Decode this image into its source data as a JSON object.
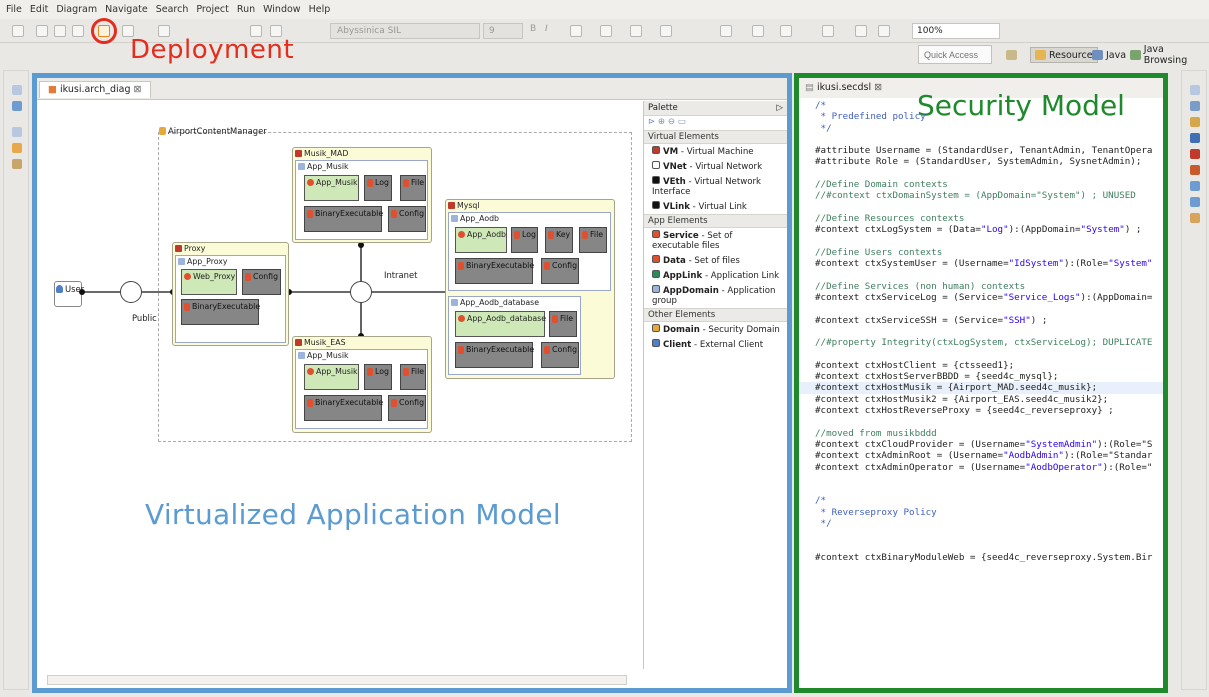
{
  "menubar": [
    "File",
    "Edit",
    "Diagram",
    "Navigate",
    "Search",
    "Project",
    "Run",
    "Window",
    "Help"
  ],
  "toolbar": {
    "font": "Abyssinica SIL",
    "size": "9",
    "zoom": "100%"
  },
  "quick_access": {
    "placeholder": "Quick Access"
  },
  "perspectives": [
    "Resource",
    "Java",
    "Java Browsing"
  ],
  "annotations": {
    "deployment": "Deployment",
    "virtualized": "Virtualized Application Model",
    "security": "Security Model"
  },
  "diagram": {
    "tab": "ikusi.arch_diag",
    "container": "AirportContentManager",
    "user": "User",
    "public": "Public",
    "intranet": "Intranet",
    "proxy": {
      "vm": "Proxy",
      "domain": "App_Proxy",
      "web": "Web_Proxy",
      "config": "Config",
      "bin": "BinaryExecutable"
    },
    "musik_mad": {
      "vm": "Musik_MAD",
      "domain": "App_Musik",
      "svc": "App_Musik",
      "log": "Log",
      "file": "File",
      "bin": "BinaryExecutable",
      "config": "Config"
    },
    "musik_eas": {
      "vm": "Musik_EAS",
      "domain": "App_Musik",
      "svc": "App_Musik",
      "log": "Log",
      "file": "File",
      "bin": "BinaryExecutable",
      "config": "Config"
    },
    "mysql": {
      "vm": "Mysql",
      "domain": "App_Aodb",
      "svc": "App_Aodb",
      "log": "Log",
      "key": "Key",
      "file": "File",
      "bin": "BinaryExecutable",
      "config": "Config",
      "domain2": "App_Aodb_database",
      "svc2": "App_Aodb_database",
      "file2": "File",
      "bin2": "BinaryExecutable",
      "config2": "Config"
    }
  },
  "palette": {
    "title": "Palette",
    "sections": [
      {
        "name": "Virtual Elements",
        "items": [
          {
            "b": "VM",
            "t": " - Virtual Machine"
          },
          {
            "b": "VNet",
            "t": " - Virtual Network"
          },
          {
            "b": "VEth",
            "t": " - Virtual Network Interface"
          },
          {
            "b": "VLink",
            "t": " - Virtual Link"
          }
        ]
      },
      {
        "name": "App Elements",
        "items": [
          {
            "b": "Service",
            "t": " - Set of executable files"
          },
          {
            "b": "Data",
            "t": " - Set of files"
          },
          {
            "b": "AppLink",
            "t": " - Application Link"
          },
          {
            "b": "AppDomain",
            "t": " - Application group"
          }
        ]
      },
      {
        "name": "Other Elements",
        "items": [
          {
            "b": "Domain",
            "t": " - Security Domain"
          },
          {
            "b": "Client",
            "t": " - External Client"
          }
        ]
      }
    ]
  },
  "security": {
    "tab": "ikusi.secdsl",
    "lines": [
      {
        "c": "jd",
        "t": "/*"
      },
      {
        "c": "jd",
        "t": " * Predefined policy"
      },
      {
        "c": "jd",
        "t": " */"
      },
      {
        "c": "",
        "t": ""
      },
      {
        "c": "",
        "t": "#attribute Username = (StandardUser, TenantAdmin, TenantOpera"
      },
      {
        "c": "",
        "t": "#attribute Role = (StandardUser, SystemAdmin, SysnetAdmin);"
      },
      {
        "c": "",
        "t": ""
      },
      {
        "c": "cm",
        "t": "//Define Domain contexts"
      },
      {
        "c": "cm",
        "t": "//#context ctxDomainSystem = (AppDomain=\"System\") ; UNUSED"
      },
      {
        "c": "",
        "t": ""
      },
      {
        "c": "cm",
        "t": "//Define Resources contexts"
      },
      {
        "c": "",
        "t": "#context ctxLogSystem = (Data=\"Log\"):(AppDomain=\"System\") ;"
      },
      {
        "c": "",
        "t": ""
      },
      {
        "c": "cm",
        "t": "//Define Users contexts"
      },
      {
        "c": "",
        "t": "#context ctxSystemUser = (Username=\"IdSystem\"):(Role=\"System\""
      },
      {
        "c": "",
        "t": ""
      },
      {
        "c": "cm",
        "t": "//Define Services (non human) contexts"
      },
      {
        "c": "",
        "t": "#context ctxServiceLog = (Service=\"Service_Logs\"):(AppDomain="
      },
      {
        "c": "",
        "t": ""
      },
      {
        "c": "",
        "t": "#context ctxServiceSSH = (Service=\"SSH\") ;"
      },
      {
        "c": "",
        "t": ""
      },
      {
        "c": "cm",
        "t": "//#property Integrity(ctxLogSystem, ctxServiceLog); DUPLICATE"
      },
      {
        "c": "",
        "t": ""
      },
      {
        "c": "",
        "t": "#context ctxHostClient = {ctsseed1};"
      },
      {
        "c": "",
        "t": "#context ctxHostServerBBDD = {seed4c_mysql};"
      },
      {
        "c": "hl",
        "t": "#context ctxHostMusik = {Airport_MAD.seed4c_musik};"
      },
      {
        "c": "",
        "t": "#context ctxHostMusik2 = {Airport_EAS.seed4c_musik2};"
      },
      {
        "c": "",
        "t": "#context ctxHostReverseProxy = {seed4c_reverseproxy} ;"
      },
      {
        "c": "",
        "t": ""
      },
      {
        "c": "cm",
        "t": "//moved from musikbddd"
      },
      {
        "c": "",
        "t": "#context ctxCloudProvider = (Username=\"SystemAdmin\"):(Role=\"S"
      },
      {
        "c": "",
        "t": "#context ctxAdminRoot = (Username=\"AodbAdmin\"):(Role=\"Standar"
      },
      {
        "c": "",
        "t": "#context ctxAdminOperator = (Username=\"AodbOperator\"):(Role=\""
      },
      {
        "c": "",
        "t": ""
      },
      {
        "c": "",
        "t": ""
      },
      {
        "c": "jd",
        "t": "/*"
      },
      {
        "c": "jd",
        "t": " * Reverseproxy Policy"
      },
      {
        "c": "jd",
        "t": " */"
      },
      {
        "c": "",
        "t": ""
      },
      {
        "c": "",
        "t": ""
      },
      {
        "c": "",
        "t": "#context ctxBinaryModuleWeb = {seed4c_reverseproxy.System.Bir"
      }
    ]
  }
}
